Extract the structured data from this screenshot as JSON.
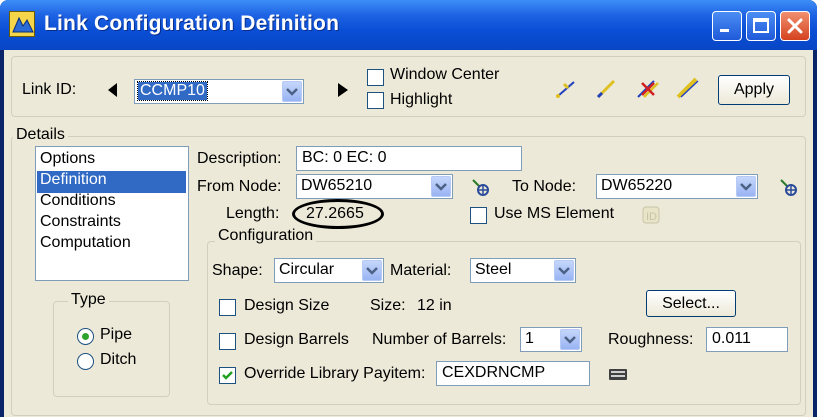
{
  "window": {
    "title": "Link Configuration Definition"
  },
  "link_id": {
    "label": "Link ID:",
    "value": "CCMP10"
  },
  "options_checkboxes": {
    "window_center": "Window Center",
    "highlight": "Highlight"
  },
  "apply_label": "Apply",
  "details": {
    "title": "Details",
    "list": [
      "Options",
      "Definition",
      "Conditions",
      "Constraints",
      "Computation"
    ],
    "selected_index": 1
  },
  "type_group": {
    "title": "Type",
    "options": [
      "Pipe",
      "Ditch"
    ],
    "selected": "Pipe"
  },
  "description": {
    "label": "Description:",
    "value": "BC: 0 EC: 0"
  },
  "from_node": {
    "label": "From Node:",
    "value": "DW65210"
  },
  "to_node": {
    "label": "To Node:",
    "value": "DW65220"
  },
  "length": {
    "label": "Length:",
    "value": "27.2665"
  },
  "use_ms_element": {
    "label": "Use MS Element",
    "checked": false
  },
  "configuration": {
    "title": "Configuration",
    "shape_label": "Shape:",
    "shape_value": "Circular",
    "material_label": "Material:",
    "material_value": "Steel",
    "design_size_label": "Design Size",
    "size_label": "Size:",
    "size_value": "12 in",
    "select_label": "Select...",
    "design_barrels_label": "Design Barrels",
    "num_barrels_label": "Number of Barrels:",
    "num_barrels_value": "1",
    "roughness_label": "Roughness:",
    "roughness_value": "0.011",
    "override_label": "Override Library Payitem:",
    "override_value": "CEXDRNCMP",
    "override_checked": true
  },
  "colors": {
    "title_bar": "#0a4fd6",
    "selection": "#316ac5",
    "dialog_bg": "#ece9d8",
    "radio_dot": "#2ea42e"
  }
}
